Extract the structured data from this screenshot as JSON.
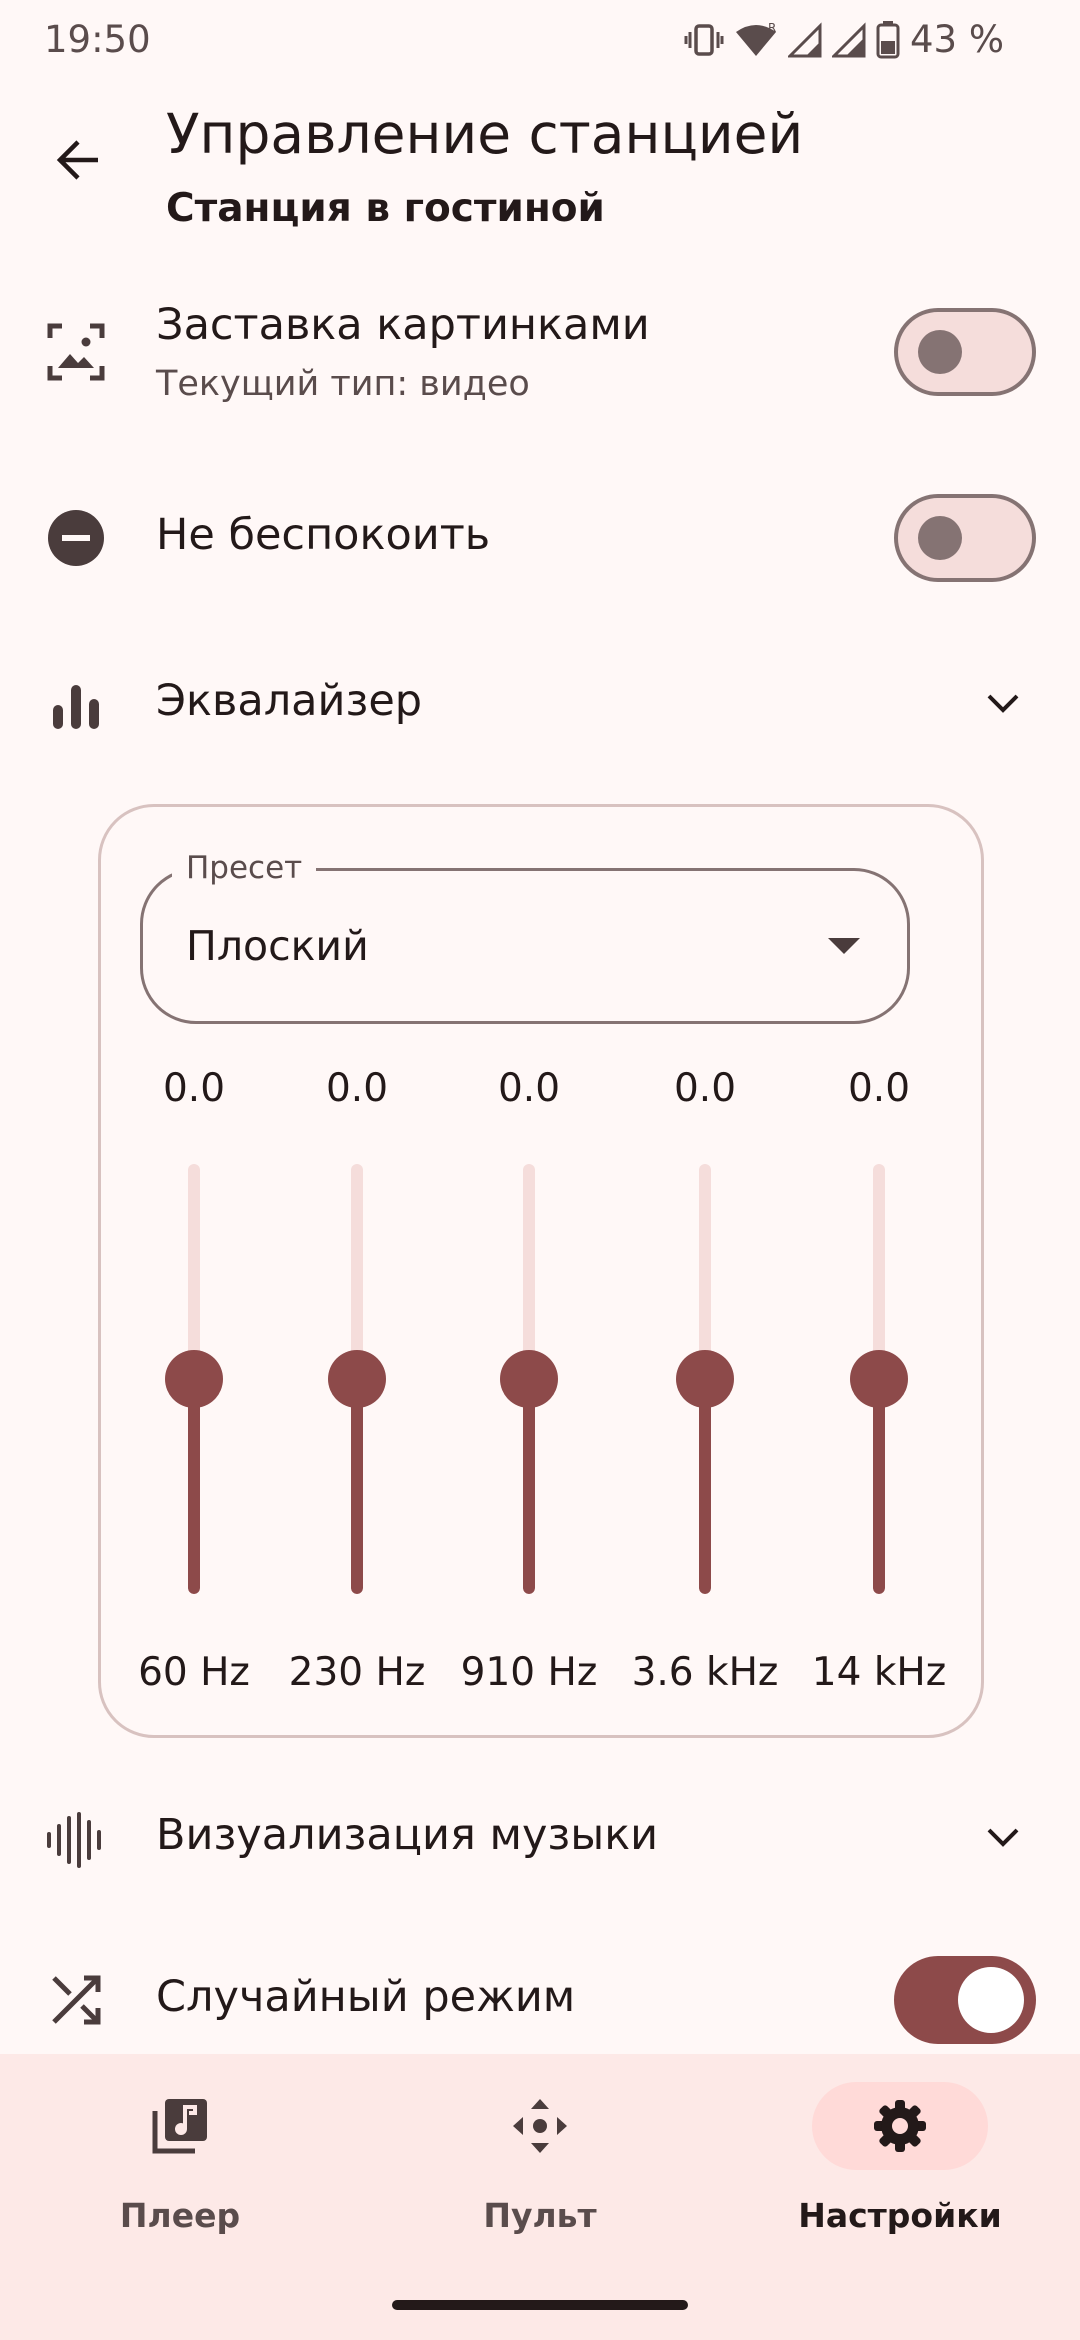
{
  "status_bar": {
    "time": "19:50",
    "battery": "43 %",
    "icons": [
      "vibrate-icon",
      "wifi-icon",
      "roaming-signal-icon",
      "signal-icon",
      "battery-icon"
    ]
  },
  "header": {
    "title": "Управление станцией",
    "subtitle": "Станция в гостиной",
    "back_icon": "arrow-back-icon"
  },
  "settings": {
    "screensaver": {
      "title": "Заставка картинками",
      "subtitle": "Текущий тип: видео",
      "icon": "image-frame-icon",
      "enabled": false
    },
    "dnd": {
      "title": "Не беспокоить",
      "icon": "do-not-disturb-icon",
      "enabled": false
    },
    "equalizer": {
      "title": "Эквалайзер",
      "icon": "equalizer-icon",
      "expanded": true
    },
    "visualization": {
      "title": "Визуализация музыки",
      "icon": "waveform-icon",
      "expanded": false
    },
    "shuffle": {
      "title": "Случайный режим",
      "icon": "shuffle-icon",
      "enabled": true
    }
  },
  "equalizer": {
    "preset_label": "Пресет",
    "preset_value": "Плоский",
    "range": [
      -1,
      1
    ],
    "bands": [
      {
        "freq": "60 Hz",
        "value": "0.0",
        "level": 0.0
      },
      {
        "freq": "230 Hz",
        "value": "0.0",
        "level": 0.0
      },
      {
        "freq": "910 Hz",
        "value": "0.0",
        "level": 0.0
      },
      {
        "freq": "3.6 kHz",
        "value": "0.0",
        "level": 0.0
      },
      {
        "freq": "14 kHz",
        "value": "0.0",
        "level": 0.0
      }
    ]
  },
  "bottom_nav": {
    "items": [
      {
        "label": "Плеер",
        "icon": "music-library-icon",
        "active": false
      },
      {
        "label": "Пульт",
        "icon": "remote-dpad-icon",
        "active": false
      },
      {
        "label": "Настройки",
        "icon": "gear-icon",
        "active": true
      }
    ]
  },
  "colors": {
    "background": "#fff8f7",
    "accent": "#8d4a4a",
    "track": "#f5dddb",
    "outline": "#857373",
    "nav_background": "#fde9e7",
    "nav_active_pill": "#ffdad8"
  }
}
